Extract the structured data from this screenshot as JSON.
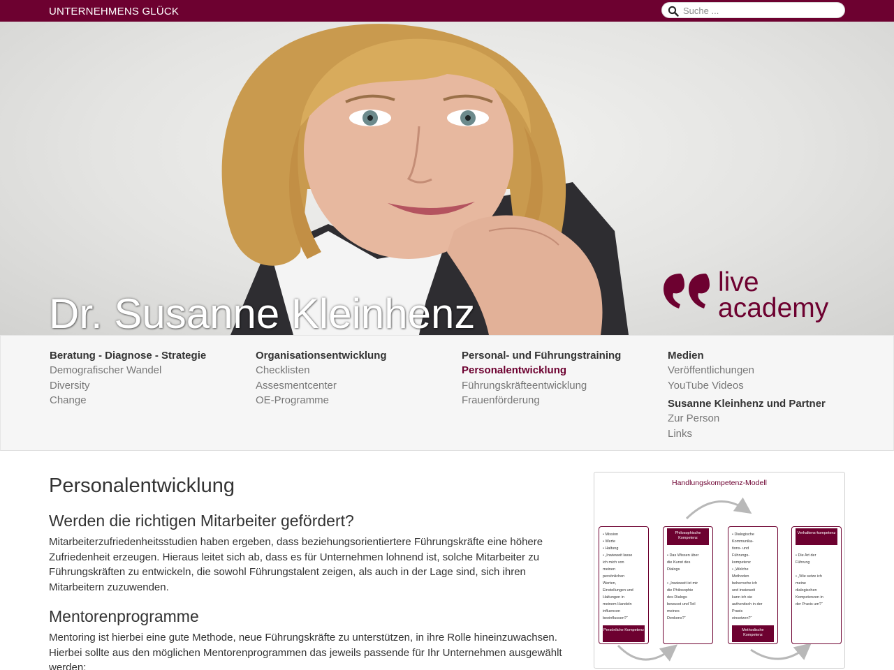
{
  "site": {
    "brand": "UNTERNEHMENS GLÜCK"
  },
  "search": {
    "placeholder": "Suche ..."
  },
  "hero": {
    "name": "Dr. Susanne Kleinhenz",
    "logo_line1": "live",
    "logo_line2": "academy"
  },
  "nav": {
    "columns": [
      {
        "heading": "Beratung - Diagnose - Strategie",
        "items": [
          "Demografischer Wandel",
          "Diversity",
          "Change"
        ]
      },
      {
        "heading": "Organisationsentwicklung",
        "items": [
          "Checklisten",
          "Assesmentcenter",
          "OE-Programme"
        ]
      },
      {
        "heading": "Personal- und Führungstraining",
        "items": [
          "Personalentwicklung",
          "Führungskräfteentwicklung",
          "Frauenförderung"
        ],
        "active_index": 0
      },
      {
        "heading": "Medien",
        "items": [
          "Veröffentlichungen",
          "YouTube Videos"
        ],
        "heading2": "Susanne Kleinhenz und Partner",
        "items2": [
          "Zur Person",
          "Links"
        ]
      }
    ]
  },
  "content": {
    "title": "Personalentwicklung",
    "section1": {
      "heading": "Werden die richtigen Mitarbeiter gefördert?",
      "text": "Mitarbeiterzufriedenheitsstudien haben ergeben, dass beziehungsorientiertere Führungskräfte eine höhere Zufriedenheit erzeugen. Hieraus leitet sich ab, dass es für Unternehmen lohnend ist, solche Mitarbeiter zu Führungskräften zu entwickeln, die sowohl Führungstalent zeigen, als auch in der Lage sind, sich ihren Mitarbeitern zuzuwenden."
    },
    "section2": {
      "heading": "Mentorenprogramme",
      "text": "Mentoring ist hierbei eine gute Methode, neue Führungskräfte zu unterstützen, in ihre Rolle hineinzuwachsen. Hierbei sollte aus den möglichen Mentorenprogrammen das jeweils passende für Ihr Unternehmen ausgewählt werden:"
    }
  },
  "figure": {
    "title": "Handlungskompetenz-Modell",
    "boxes": [
      {
        "text": "• Mission\n• Werte\n• Haltung\n• „Inwieweit lasse\nich mich von\nmeinen\npersönlichen\nWerten,\nEinstellungen und\nHaltungen in\nmeinem Handeln\ninfluencen\nbeeinflussen?“",
        "caption_bottom": "Persönliche Kompetenz"
      },
      {
        "caption_top": "Philosophische Kompetenz",
        "text": "• Das Wissen über\ndie Kunst des\nDialogs\n\n• „Inwieweit ist mir\ndie Philosophie\ndes Dialogs\nbewusst und Teil\nmeines\nDenkens?“"
      },
      {
        "text": "• Dialogische\nKommunika-\ntions- und\nFührungs-\nkompetenz\n• „Welche\nMethoden\nbeherrsche ich\nund inwieweit\nkann ich sie\nauthentisch in der\nPraxis\neinsetzen?“",
        "caption_bottom": "Methodische Kompetenz"
      },
      {
        "caption_top": "Verhaltens-kompetenz",
        "text": "• Die Art der\nFührung\n\n• „Wie setze ich\nmeine\ndialogischen\nKompetenzen in\nder Praxis um?“"
      }
    ]
  },
  "colors": {
    "brand": "#6d0130",
    "nav_bg": "#f6f6f6",
    "muted": "#777777"
  }
}
